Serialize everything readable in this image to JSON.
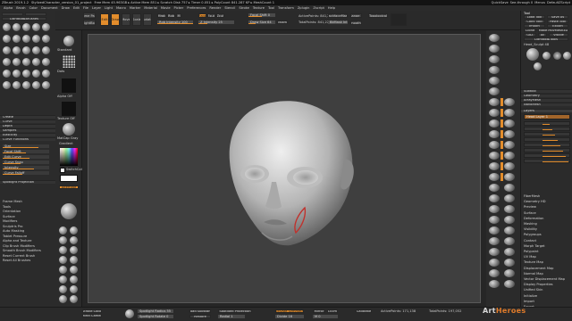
{
  "titlebar": {
    "app": "ZBrush 2019.1.2",
    "file": "StylizedCharacter_version_01_project",
    "stats": "Free Mem 45.963GB ▸ Active Mem 851 ▸ Scratch Disk 757 ▸ Timer 0.051 ▸ PolyCount 841.287 KP ▸ MeshCount 1",
    "quicksave": "QuickSave",
    "seethrough": "See-through 0",
    "menus": "Menus",
    "default_script": "DefaultZScript"
  },
  "menubar": [
    "Alpha",
    "Brush",
    "Color",
    "Document",
    "Draw",
    "Edit",
    "File",
    "Layer",
    "Light",
    "Macro",
    "Marker",
    "Material",
    "Movie",
    "Picker",
    "Preferences",
    "Render",
    "Stencil",
    "Stroke",
    "Texture",
    "Tool",
    "Transform",
    "Zplugin",
    "Zscript",
    "Help"
  ],
  "toolbar": {
    "home": "Home Page",
    "lightbox": "LightBox",
    "lightbox_brushes": "LightBox▸Brushes",
    "edit": "Edit",
    "draw": "Draw",
    "move": "Move",
    "scale": "Scale",
    "rotate": "Rotate",
    "mrgb": "Mrgb",
    "rgb": "Rgb",
    "m": "M",
    "zadd": "Zadd",
    "zsub": "Zsub",
    "zcut": "Zcut",
    "rgb_intensity": "Rgb Intensity 100",
    "z_intensity": "Z Intensity 25",
    "focal_shift": "Focal Shift 0",
    "draw_size": "Draw Size 64",
    "dynamic": "Dynamic",
    "active_points": "ActivePoints: 841,226",
    "total_points": "TotalPoints: 841,226",
    "backface_mask": "BackfaceMask",
    "bkmask_int": "BkMask Int",
    "topological": "Topological",
    "range": "Range 5",
    "smooth": "Smooth 5"
  },
  "left": {
    "brush_label": "Standard",
    "stroke_label": "Dots",
    "alpha_label": "Alpha Off",
    "texture_label": "Texture Off",
    "material_label": "MatCap Gray",
    "gradient": "Gradient",
    "switch_color": "SwitchColor",
    "alternate": "Alternate",
    "menu_items": [
      "Create",
      "Curve",
      "Depth",
      "Samples",
      "Elasticity",
      "Curve Functions",
      "Size",
      "Focal Shift",
      "Alpha Modifiers",
      "Smooth Stroke",
      "Frame Mesh",
      "Tools",
      "Orientation",
      "Surface",
      "Modifiers",
      "Sculptris Pro",
      "Auto Masking",
      "Tablet Pressure",
      "Alpha and Texture",
      "Clip Brush Modifiers",
      "Smooth Brush Modifiers",
      "Reset Current Brush",
      "Reset All Brushes"
    ],
    "curve_buttons": [
      "Edit Curve",
      "Curve Snap",
      "Intensity",
      "Curve Falloff"
    ],
    "section_labels": [
      "Spotlight Projection"
    ]
  },
  "right": {
    "tool_title": "Tool",
    "load_tool": "Load Tool",
    "save_as": "Save As",
    "copy_tool": "Copy Tool",
    "paste_tool": "Paste Tool",
    "import": "Import",
    "export": "Export",
    "clone": "Clone",
    "make_polymesh": "Make PolyMesh3D",
    "goz": "GoZ",
    "all": "All",
    "visible": "Visible",
    "lightbox_tools": "Lightbox▸Tools",
    "current_tool": "Head_Sculpt 48",
    "menu_items": [
      "Subtool",
      "Geometry",
      "ArrayMesh",
      "NanoMesh",
      "Layers"
    ],
    "lower_items": [
      "FiberMesh",
      "Geometry HD",
      "Preview",
      "Surface",
      "Deformation",
      "Masking",
      "Visibility",
      "Polygroups",
      "Contact",
      "Morph Target",
      "Polypaint",
      "UV Map",
      "Texture Map",
      "Displacement Map",
      "Normal Map",
      "Vector Displacement Map",
      "Display Properties",
      "Unified Skin",
      "Initialize",
      "Import",
      "Export"
    ],
    "layer_name": "Head Layer 1"
  },
  "shelf": {
    "labels": [
      "Persp",
      "Floor",
      "Local",
      "Frame",
      "Move",
      "Scale",
      "Rotate",
      "Line Fill",
      "PolyF",
      "Transp",
      "Solo",
      "Xpose"
    ]
  },
  "bottom": {
    "items": [
      "Stroke Color",
      "Select Camera",
      "Load Spotlight",
      "Restore",
      "Spotlight Projection",
      "Activate Symmetry",
      "Mirror",
      "LSym",
      "Calibrate",
      "ActivePoints: 171,138",
      "TotalPoints: 197,052"
    ],
    "fields": [
      "Spotlight Radius 55",
      "Spotlight Rotate 0",
      "Radial 1",
      "Divide 16",
      "M 0"
    ]
  },
  "watermark": {
    "main": "Art",
    "accent": "Heroes"
  }
}
